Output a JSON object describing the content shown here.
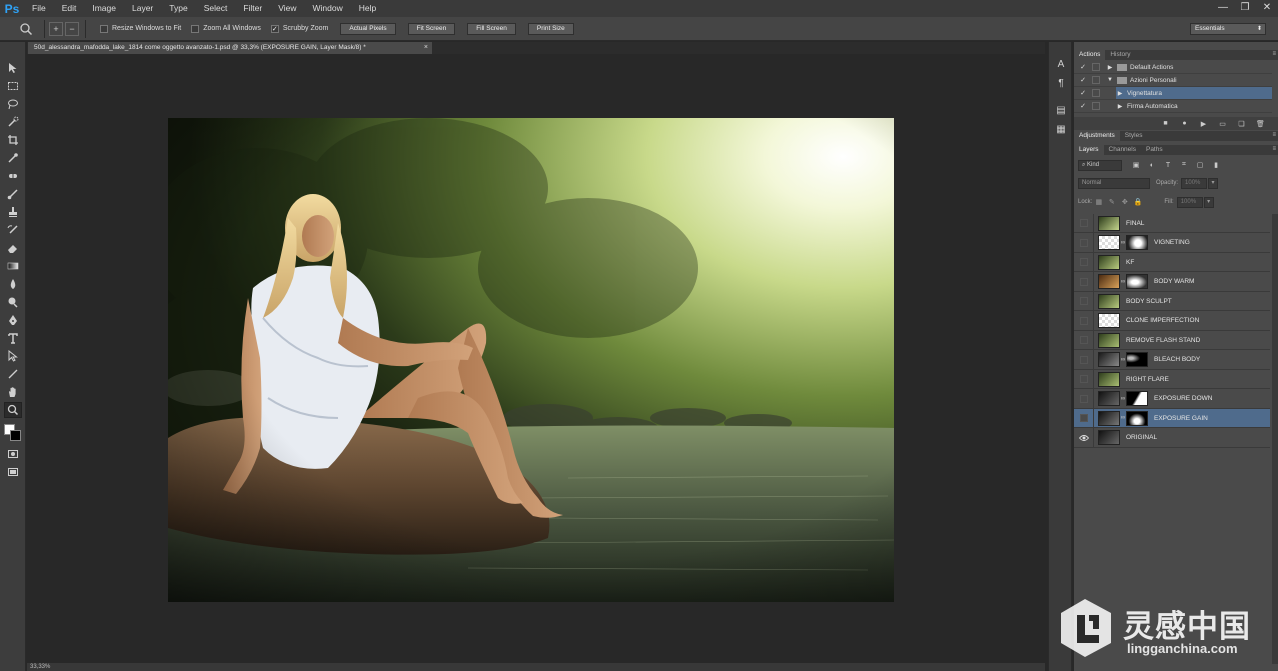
{
  "app": {
    "logo": "Ps"
  },
  "menu": [
    "File",
    "Edit",
    "Image",
    "Layer",
    "Type",
    "Select",
    "Filter",
    "View",
    "Window",
    "Help"
  ],
  "window_controls": {
    "minimize": "—",
    "restore": "❐",
    "close": "✕"
  },
  "options_bar": {
    "checkboxes": [
      {
        "label": "Resize Windows to Fit",
        "checked": false
      },
      {
        "label": "Zoom All Windows",
        "checked": false
      },
      {
        "label": "Scrubby Zoom",
        "checked": true
      }
    ],
    "buttons": [
      "Actual Pixels",
      "Fit Screen",
      "Fill Screen",
      "Print Size"
    ],
    "workspace": "Essentials"
  },
  "document": {
    "tab_title": "50d_alessandra_mafodda_lake_1814 come oggetto avanzato-1.psd @ 33,3% (EXPOSURE GAIN, Layer Mask/8) *",
    "close": "×",
    "status": "33,33%"
  },
  "actions_panel": {
    "tabs": [
      "Actions",
      "History"
    ],
    "rows": [
      {
        "label": "Default Actions",
        "indent": 0,
        "folder": true,
        "expanded": false,
        "selected": false
      },
      {
        "label": "Azioni Personali",
        "indent": 0,
        "folder": true,
        "expanded": true,
        "selected": false
      },
      {
        "label": "Vignettatura",
        "indent": 1,
        "folder": false,
        "expanded": false,
        "selected": true
      },
      {
        "label": "Firma Automatica",
        "indent": 1,
        "folder": false,
        "expanded": false,
        "selected": false
      }
    ]
  },
  "adjustments_panel": {
    "tabs": [
      "Adjustments",
      "Styles"
    ]
  },
  "layers_panel": {
    "tabs": [
      "Layers",
      "Channels",
      "Paths"
    ],
    "kind": "Kind",
    "blend_mode": "Normal",
    "opacity_label": "Opacity:",
    "opacity": "100%",
    "lock_label": "Lock:",
    "fill_label": "Fill:",
    "fill": "100%",
    "layers": [
      {
        "name": "FINAL",
        "visible": false,
        "mask": false,
        "selected": false
      },
      {
        "name": "VIGNETING",
        "visible": false,
        "mask": true,
        "selected": false
      },
      {
        "name": "KF",
        "visible": false,
        "mask": false,
        "selected": false
      },
      {
        "name": "BODY WARM",
        "visible": false,
        "mask": true,
        "selected": false
      },
      {
        "name": "BODY SCULPT",
        "visible": false,
        "mask": false,
        "selected": false
      },
      {
        "name": "CLONE IMPERFECTION",
        "visible": false,
        "mask": false,
        "selected": false
      },
      {
        "name": "REMOVE FLASH STAND",
        "visible": false,
        "mask": false,
        "selected": false
      },
      {
        "name": "BLEACH BODY",
        "visible": false,
        "mask": true,
        "selected": false
      },
      {
        "name": "RIGHT FLARE",
        "visible": false,
        "mask": false,
        "selected": false
      },
      {
        "name": "EXPOSURE DOWN",
        "visible": false,
        "mask": true,
        "selected": false
      },
      {
        "name": "EXPOSURE GAIN",
        "visible": false,
        "mask": true,
        "selected": true
      },
      {
        "name": "ORIGINAL",
        "visible": true,
        "mask": false,
        "selected": false
      }
    ]
  },
  "watermark": {
    "brand": "灵感中国",
    "url": "lingganchina.com"
  },
  "colors": {
    "accent": "#2fa3f7",
    "selection": "#4f6b8c"
  }
}
